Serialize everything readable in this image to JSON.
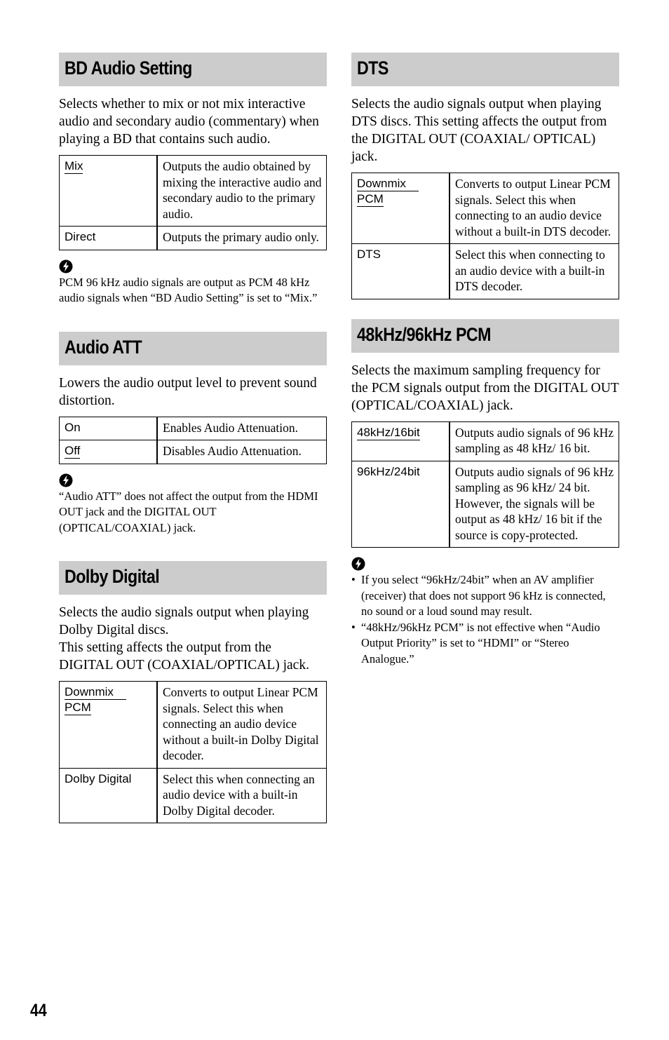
{
  "page_number": "44",
  "left_column": {
    "bd_audio_setting": {
      "title": "BD Audio Setting",
      "intro": "Selects whether to mix or not mix interactive audio and secondary audio (commentary) when playing a BD that contains such audio.",
      "options": [
        {
          "name": "Mix",
          "default": true,
          "description": "Outputs the audio obtained by mixing the interactive audio and secondary audio to the primary audio."
        },
        {
          "name": "Direct",
          "default": false,
          "description": "Outputs the primary audio only."
        }
      ],
      "hint_icon": "hint-icon",
      "hint": "PCM 96 kHz audio signals are output as PCM 48 kHz audio signals when “BD Audio Setting” is set to “Mix.”"
    },
    "audio_att": {
      "title": "Audio ATT",
      "intro": "Lowers the audio output level to prevent sound distortion.",
      "options": [
        {
          "name": "On",
          "default": false,
          "description": "Enables Audio Attenuation."
        },
        {
          "name": "Off",
          "default": true,
          "description": "Disables Audio Attenuation."
        }
      ],
      "hint_icon": "hint-icon",
      "hint": "“Audio ATT” does not affect the output from the HDMI OUT jack and the DIGITAL OUT (OPTICAL/COAXIAL) jack."
    },
    "dolby_digital": {
      "title": "Dolby Digital",
      "intro_1": "Selects the audio signals output when playing Dolby Digital discs.",
      "intro_2": "This setting affects the output from the DIGITAL OUT (COAXIAL/OPTICAL) jack.",
      "options": [
        {
          "name_line1": "Downmix",
          "name_line2": "PCM",
          "default": true,
          "description": "Converts to output Linear PCM signals. Select this when connecting an audio device without a built-in Dolby Digital decoder."
        },
        {
          "name": "Dolby Digital",
          "default": false,
          "description": "Select this when connecting an audio device with a built-in Dolby Digital decoder."
        }
      ]
    }
  },
  "right_column": {
    "dts": {
      "title": "DTS",
      "intro": "Selects the audio signals output when playing DTS discs. This setting affects the output from the DIGITAL OUT (COAXIAL/ OPTICAL) jack.",
      "options": [
        {
          "name_line1": "Downmix",
          "name_line2": "PCM",
          "default": true,
          "description": "Converts to output Linear PCM signals. Select this when connecting to an audio device without a built-in DTS decoder."
        },
        {
          "name": "DTS",
          "default": false,
          "description": "Select this when connecting to an audio device with a built-in DTS decoder."
        }
      ]
    },
    "pcm_48_96": {
      "title": "48kHz/96kHz PCM",
      "intro": "Selects the maximum sampling frequency for the PCM signals output from the DIGITAL OUT (OPTICAL/COAXIAL) jack.",
      "options": [
        {
          "name": "48kHz/16bit",
          "default": true,
          "description": "Outputs audio signals of 96 kHz sampling as 48 kHz/ 16 bit."
        },
        {
          "name": "96kHz/24bit",
          "default": false,
          "description": "Outputs audio signals of 96 kHz sampling as 96 kHz/ 24 bit. However, the signals will be output as 48 kHz/ 16 bit if the source is copy-protected."
        }
      ],
      "hint_icon": "hint-icon",
      "bullet": "•",
      "hints": [
        "If you select “96kHz/24bit” when an AV amplifier (receiver) that does not support 96 kHz is connected, no sound or a loud sound may result.",
        "“48kHz/96kHz PCM” is not effective when “Audio Output Priority” is set to “HDMI” or “Stereo Analogue.”"
      ]
    }
  }
}
